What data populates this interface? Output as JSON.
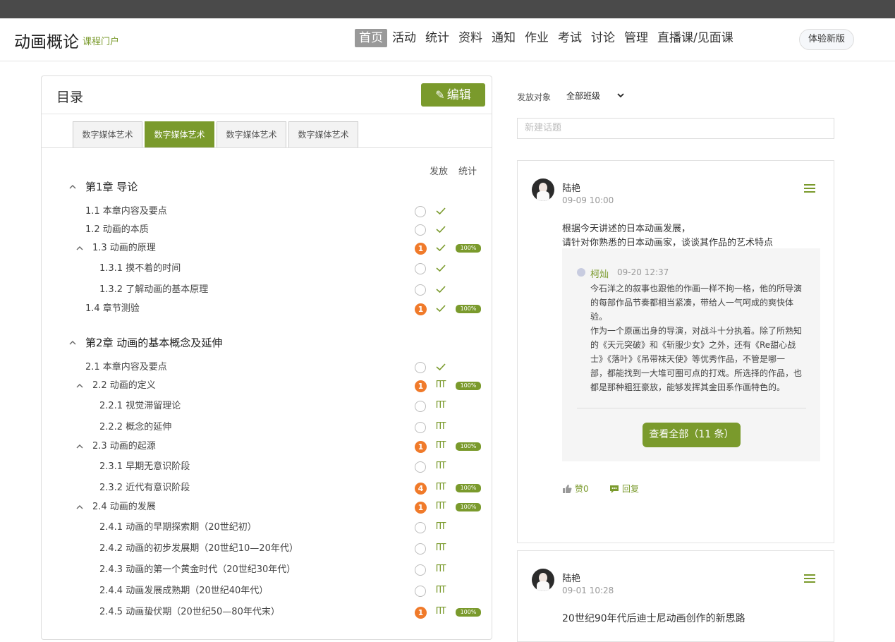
{
  "header": {
    "course_title": "动画概论",
    "portal_label": "课程门户",
    "nav": [
      "首页",
      "活动",
      "统计",
      "资料",
      "通知",
      "作业",
      "考试",
      "讨论",
      "管理",
      "直播课/见面课"
    ],
    "try_new": "体验新版"
  },
  "toc": {
    "title": "目录",
    "edit_label": "编辑",
    "tabs": [
      "数字媒体艺术",
      "数字媒体艺术",
      "数字媒体艺术",
      "数字媒体艺术"
    ],
    "active_tab": 1,
    "col_publish": "发放",
    "col_stats": "统计",
    "rows": [
      {
        "label": "第1章 导论",
        "kind": "chapter",
        "caret": true
      },
      {
        "label": "1.1  本章内容及要点",
        "kind": "section",
        "badge": null,
        "mark": "check",
        "pct": null
      },
      {
        "label": "1.2  动画的本质",
        "kind": "section",
        "badge": null,
        "mark": "check",
        "pct": null
      },
      {
        "label": "1.3  动画的原理",
        "kind": "section",
        "caret": true,
        "badge": "1",
        "mark": "check",
        "pct": "100%"
      },
      {
        "label": "1.3.1 摸不着的时间",
        "kind": "sub",
        "badge": null,
        "mark": "check",
        "pct": null
      },
      {
        "label": "1.3.2 了解动画的基本原理",
        "kind": "sub",
        "badge": null,
        "mark": "check",
        "pct": null
      },
      {
        "label": "1.4  章节测验",
        "kind": "section",
        "badge": "1",
        "mark": "check",
        "pct": "100%"
      },
      {
        "label": "第2章 动画的基本概念及延伸",
        "kind": "chapter",
        "caret": true
      },
      {
        "label": "2.1  本章内容及要点",
        "kind": "section",
        "badge": null,
        "mark": "check",
        "pct": null
      },
      {
        "label": "2.2  动画的定义",
        "kind": "section",
        "caret": true,
        "badge": "1",
        "mark": "pi",
        "pct": "100%"
      },
      {
        "label": "2.2.1 视觉滞留理论",
        "kind": "sub",
        "badge": null,
        "mark": "pi",
        "pct": null
      },
      {
        "label": "2.2.2 概念的延伸",
        "kind": "sub",
        "badge": null,
        "mark": "pi",
        "pct": null
      },
      {
        "label": "2.3  动画的起源",
        "kind": "section",
        "caret": true,
        "badge": "1",
        "mark": "pi",
        "pct": "100%"
      },
      {
        "label": "2.3.1 早期无意识阶段",
        "kind": "sub",
        "badge": null,
        "mark": "pi",
        "pct": null
      },
      {
        "label": "2.3.2 近代有意识阶段",
        "kind": "sub",
        "badge": "4",
        "mark": "pi",
        "pct": "100%"
      },
      {
        "label": "2.4  动画的发展",
        "kind": "section",
        "caret": true,
        "badge": "1",
        "mark": "pi",
        "pct": "100%"
      },
      {
        "label": "2.4.1 动画的早期探索期（20世纪初）",
        "kind": "sub",
        "badge": null,
        "mark": "pi",
        "pct": null
      },
      {
        "label": "2.4.2 动画的初步发展期（20世纪10—20年代）",
        "kind": "sub",
        "badge": null,
        "mark": "pi",
        "pct": null
      },
      {
        "label": "2.4.3 动画的第一个黄金时代（20世纪30年代）",
        "kind": "sub",
        "badge": null,
        "mark": "pi",
        "pct": null
      },
      {
        "label": "2.4.4 动画发展成熟期（20世纪40年代）",
        "kind": "sub",
        "badge": null,
        "mark": "pi",
        "pct": null
      },
      {
        "label": "2.4.5 动画蛰伏期（20世纪50—80年代末）",
        "kind": "sub",
        "badge": "1",
        "mark": "pi",
        "pct": "100%"
      }
    ],
    "pi_glyph": "ПТ"
  },
  "discussion": {
    "dist_label": "发放对象",
    "dist_value": "全部班级",
    "new_topic_placeholder": "新建话题",
    "posts": [
      {
        "author": "陆艳",
        "time": "09-09 10:00",
        "lines": [
          "根据今天讲述的日本动画发展，",
          "请针对你熟悉的日本动画家，谈谈其作品的艺术特点"
        ],
        "reply": {
          "author": "柯灿",
          "time": "09-20 12:37",
          "lines": [
            "今石洋之的叙事也跟他的作画一样不拘一格，他的所导演",
            "的每部作品节奏都相当紧凑，带给人一气呵成的爽快体",
            "验。",
            "作为一个原画出身的导演，对战斗十分执着。除了所熟知",
            "的《天元突破》和《斩服少女》之外，还有《Re甜心战",
            "士》《落叶》《吊带袜天使》等优秀作品，不管是哪一",
            "部，都能找到一大堆可圈可点的打戏。所选择的作品，也",
            "都是那种粗狂豪放，能够发挥其金田系作画特色的。"
          ]
        },
        "view_all": "查看全部（11 条）",
        "like": "赞0",
        "reply_label": "回复"
      },
      {
        "author": "陆艳",
        "time": "09-01 10:28",
        "lines": [
          "20世纪90年代后迪士尼动画创作的新思路"
        ]
      }
    ]
  },
  "colors": {
    "accent": "#7a9a2c",
    "badge": "#f07a2a",
    "topbar": "#4a4a4a"
  }
}
